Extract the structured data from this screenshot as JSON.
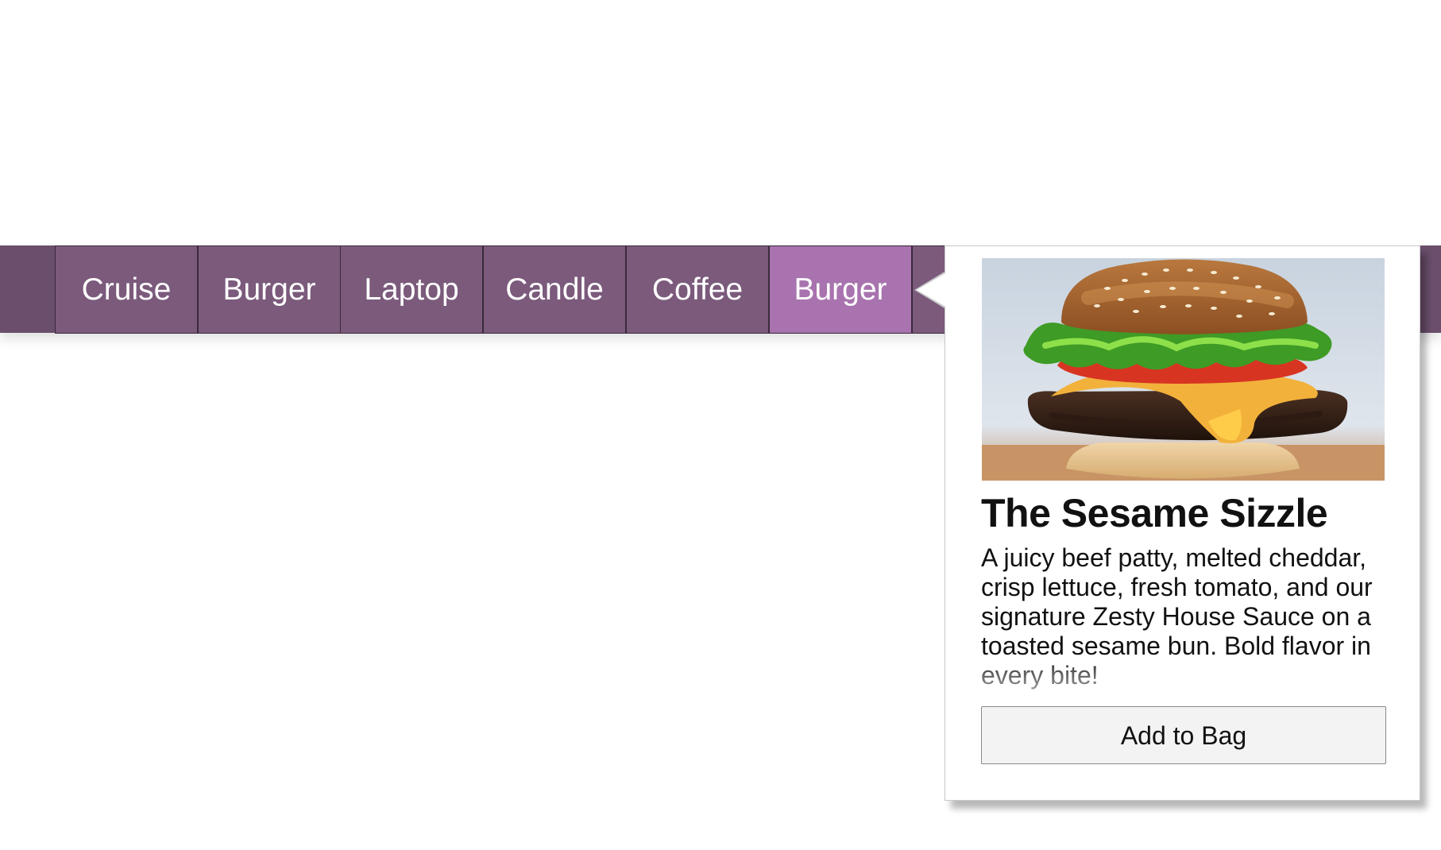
{
  "nav": {
    "tabs": [
      {
        "label": "Cruise"
      },
      {
        "label": "Burger"
      },
      {
        "label": "Laptop"
      },
      {
        "label": "Candle"
      },
      {
        "label": "Coffee"
      },
      {
        "label": "Burger",
        "active": true
      }
    ]
  },
  "popover": {
    "image_icon": "burger-image",
    "title": "The Sesame Sizzle",
    "description": "A juicy beef patty, melted cheddar, crisp lettuce, fresh tomato, and our signature Zesty House Sauce on a toasted sesame bun. Bold flavor in every bite!",
    "button_label": "Add to Bag"
  },
  "colors": {
    "nav_background": "#6a4e6b",
    "tab_background": "#7b5a7c",
    "tab_active": "#a873ae",
    "tab_border": "#3b2a3c",
    "button_background": "#f3f3f3"
  }
}
